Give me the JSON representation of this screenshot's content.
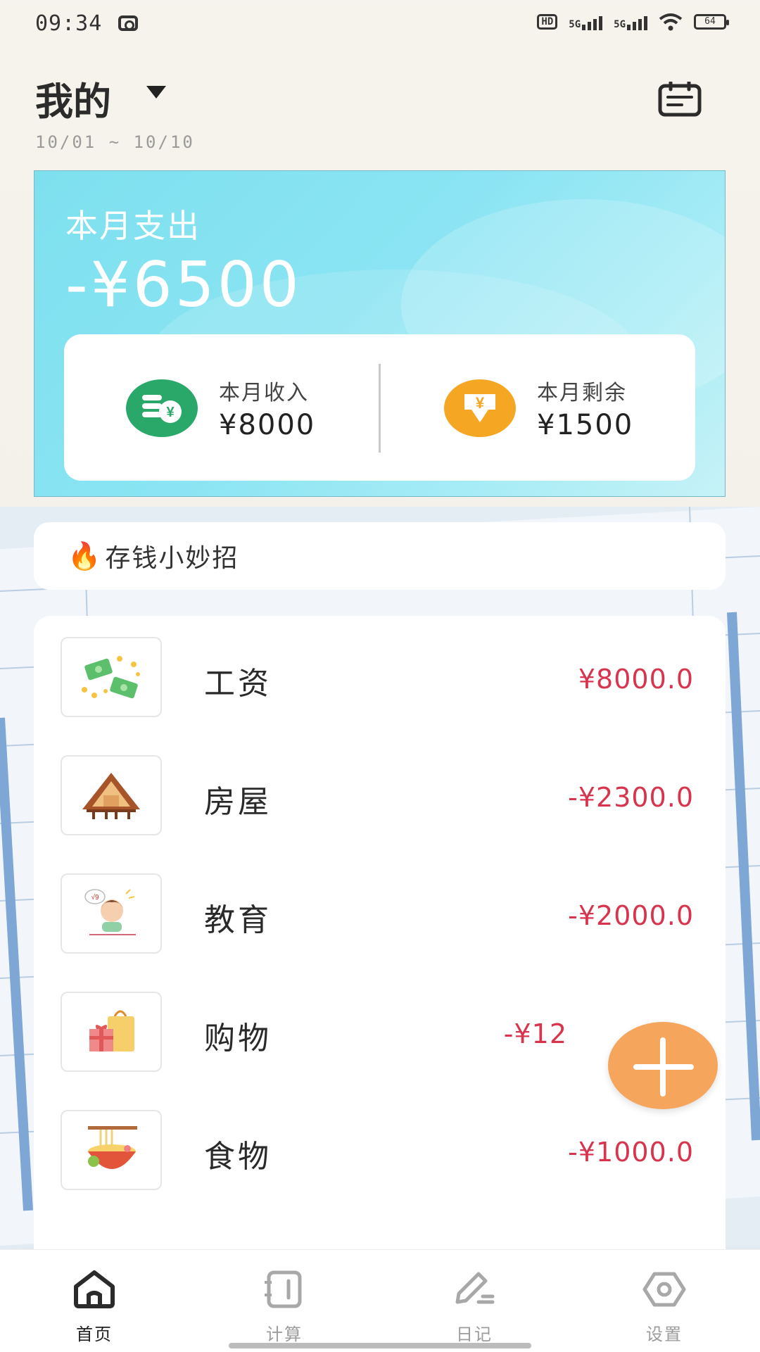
{
  "status_bar": {
    "time": "09:34",
    "hd_label": "HD",
    "signal_1": "5G",
    "signal_2": "5G",
    "battery": "64"
  },
  "header": {
    "title": "我的",
    "date_range": "10/01 ~ 10/10"
  },
  "summary": {
    "expense_label": "本月支出",
    "expense_amount": "-¥6500",
    "income_label": "本月收入",
    "income_amount": "¥8000",
    "remaining_label": "本月剩余",
    "remaining_amount": "¥1500"
  },
  "tips": {
    "icon": "🔥",
    "text": "存钱小妙招"
  },
  "records": [
    {
      "category": "工资",
      "amount": "¥8000.0",
      "icon": "money-icon"
    },
    {
      "category": "房屋",
      "amount": "-¥2300.0",
      "icon": "house-icon"
    },
    {
      "category": "教育",
      "amount": "-¥2000.0",
      "icon": "education-icon"
    },
    {
      "category": "购物",
      "amount": "-¥12",
      "icon": "shopping-bag-icon"
    },
    {
      "category": "食物",
      "amount": "-¥1000.0",
      "icon": "food-bowl-icon"
    }
  ],
  "nav": [
    {
      "label": "首页",
      "icon": "home-icon",
      "active": true
    },
    {
      "label": "计算",
      "icon": "notebook-icon",
      "active": false
    },
    {
      "label": "日记",
      "icon": "pen-icon",
      "active": false
    },
    {
      "label": "设置",
      "icon": "settings-icon",
      "active": false
    }
  ],
  "colors": {
    "accent_expense": "#d8344d",
    "banner": "#8ae4f3",
    "fab": "#f6a55c",
    "income_icon": "#2aa86a",
    "remain_icon": "#f5a623"
  }
}
